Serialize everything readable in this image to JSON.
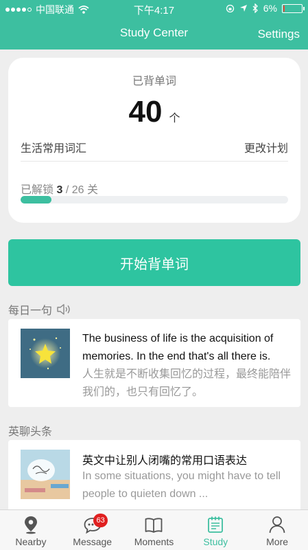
{
  "status_bar": {
    "carrier": "中国联通",
    "time": "下午4:17",
    "battery": "6%",
    "battery_level": 0.06
  },
  "navbar": {
    "title": "Study Center",
    "settings_label": "Settings"
  },
  "summary": {
    "learned_label": "已背单词",
    "learned_count": "40",
    "count_unit": "个",
    "wordlist": "生活常用词汇",
    "change_plan": "更改计划",
    "unlocked_prefix": "已解锁",
    "unlocked_count": "3",
    "unlocked_total": "/ 26 关",
    "progress": 0.115
  },
  "start_button": "开始背单词",
  "daily_sentence": {
    "section_label": "每日一句",
    "english": "The business of life is the acquisition of memories. In the end that's all there is.",
    "chinese": "人生就是不断收集回忆的过程，最终能陪伴我们的，也只有回忆了。"
  },
  "headlines": {
    "section_label": "英聊头条",
    "title": "英文中让别人闭嘴的常用口语表达",
    "desc": "In some situations, you might have to tell people to quieten down ..."
  },
  "tabs": [
    {
      "label": "Nearby",
      "icon": "location-pin-icon"
    },
    {
      "label": "Message",
      "icon": "chat-bubble-icon",
      "badge": "63"
    },
    {
      "label": "Moments",
      "icon": "book-icon"
    },
    {
      "label": "Study",
      "icon": "calendar-check-icon",
      "active": true
    },
    {
      "label": "More",
      "icon": "person-icon"
    }
  ],
  "colors": {
    "accent": "#3dbfa0",
    "badge": "#e02020"
  }
}
